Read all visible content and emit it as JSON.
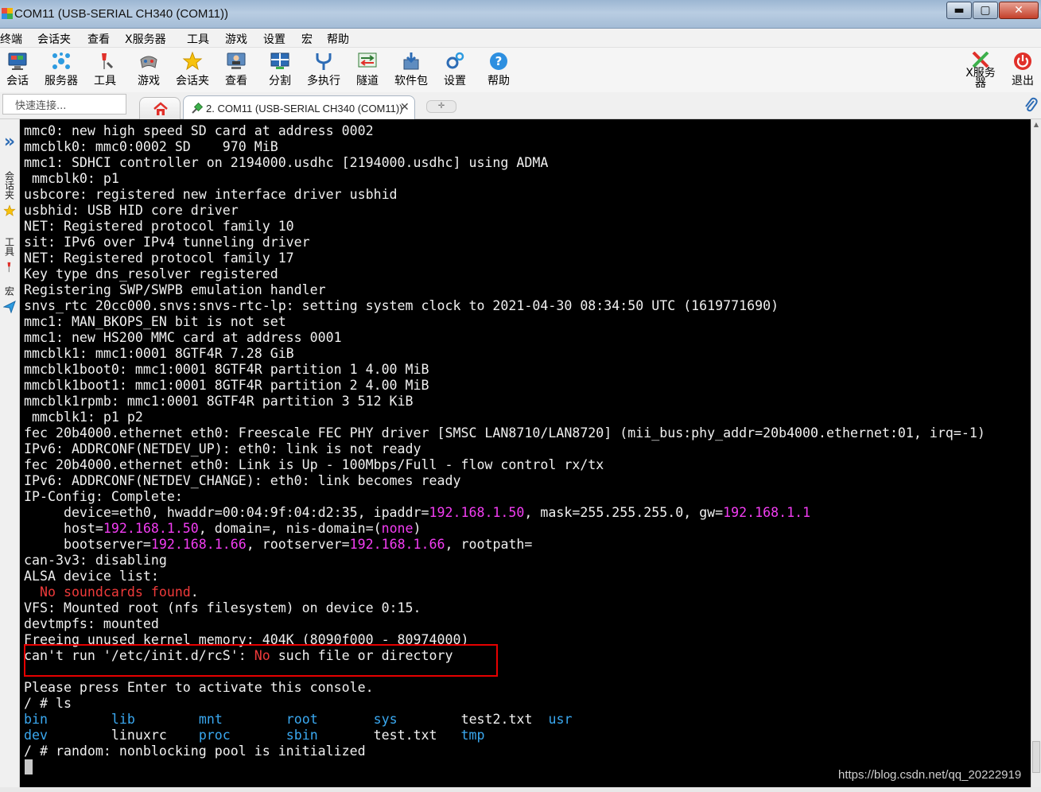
{
  "window": {
    "title": "COM11  (USB-SERIAL CH340 (COM11))",
    "minimize": "▬",
    "maximize": "▢",
    "close": "✕"
  },
  "menu": [
    "终端",
    "会话夹",
    "查看",
    "X服务器",
    "工具",
    "游戏",
    "设置",
    "宏",
    "帮助"
  ],
  "toolbar": {
    "items": [
      {
        "label": "会话",
        "icon": "session-monitor-icon"
      },
      {
        "label": "服务器",
        "icon": "servers-icon"
      },
      {
        "label": "工具",
        "icon": "tools-icon"
      },
      {
        "label": "游戏",
        "icon": "games-icon"
      },
      {
        "label": "会话夹",
        "icon": "star-icon"
      },
      {
        "label": "查看",
        "icon": "view-monitor-icon"
      },
      {
        "label": "分割",
        "icon": "split-icon"
      },
      {
        "label": "多执行",
        "icon": "multi-exec-icon"
      },
      {
        "label": "隧道",
        "icon": "tunnel-icon"
      },
      {
        "label": "软件包",
        "icon": "packages-icon"
      },
      {
        "label": "设置",
        "icon": "settings-icon"
      },
      {
        "label": "帮助",
        "icon": "help-icon"
      }
    ],
    "xserver": {
      "line1": "X服务",
      "line2": "器"
    },
    "exit": "退出"
  },
  "tabs": {
    "quick_connect_placeholder": "快速连接...",
    "session_tab": "2. COM11  (USB-SERIAL CH340 (COM11))",
    "close": "✕",
    "new_tab": "✛"
  },
  "sidebar": {
    "collapse": "»",
    "favorites": "会话夹",
    "tools": "工具",
    "macros": "宏"
  },
  "terminal": {
    "lines": [
      [
        {
          "t": "mmc0: new high speed SD card at address 0002"
        }
      ],
      [
        {
          "t": "mmcblk0: mmc0:0002 SD    970 MiB"
        }
      ],
      [
        {
          "t": "mmc1: SDHCI controller on 2194000.usdhc [2194000.usdhc] using ADMA"
        }
      ],
      [
        {
          "t": " mmcblk0: p1"
        }
      ],
      [
        {
          "t": "usbcore: registered new interface driver usbhid"
        }
      ],
      [
        {
          "t": "usbhid: USB HID core driver"
        }
      ],
      [
        {
          "t": "NET: Registered protocol family 10"
        }
      ],
      [
        {
          "t": "sit: IPv6 over IPv4 tunneling driver"
        }
      ],
      [
        {
          "t": "NET: Registered protocol family 17"
        }
      ],
      [
        {
          "t": "Key type dns_resolver registered"
        }
      ],
      [
        {
          "t": "Registering SWP/SWPB emulation handler"
        }
      ],
      [
        {
          "t": "snvs_rtc 20cc000.snvs:snvs-rtc-lp: setting system clock to 2021-04-30 08:34:50 UTC (1619771690)"
        }
      ],
      [
        {
          "t": "mmc1: MAN_BKOPS_EN bit is not set"
        }
      ],
      [
        {
          "t": "mmc1: new HS200 MMC card at address 0001"
        }
      ],
      [
        {
          "t": "mmcblk1: mmc1:0001 8GTF4R 7.28 GiB"
        }
      ],
      [
        {
          "t": "mmcblk1boot0: mmc1:0001 8GTF4R partition 1 4.00 MiB"
        }
      ],
      [
        {
          "t": "mmcblk1boot1: mmc1:0001 8GTF4R partition 2 4.00 MiB"
        }
      ],
      [
        {
          "t": "mmcblk1rpmb: mmc1:0001 8GTF4R partition 3 512 KiB"
        }
      ],
      [
        {
          "t": " mmcblk1: p1 p2"
        }
      ],
      [
        {
          "t": "fec 20b4000.ethernet eth0: Freescale FEC PHY driver [SMSC LAN8710/LAN8720] (mii_bus:phy_addr=20b4000.ethernet:01, irq=-1)"
        }
      ],
      [
        {
          "t": "IPv6: ADDRCONF(NETDEV_UP): eth0: link is not ready"
        }
      ],
      [
        {
          "t": "fec 20b4000.ethernet eth0: Link is Up - 100Mbps/Full - flow control rx/tx"
        }
      ],
      [
        {
          "t": "IPv6: ADDRCONF(NETDEV_CHANGE): eth0: link becomes ready"
        }
      ],
      [
        {
          "t": "IP-Config: Complete:"
        }
      ],
      [
        {
          "t": "     device=eth0, hwaddr=00:04:9f:04:d2:35, ipaddr="
        },
        {
          "t": "192.168.1.50",
          "c": "ip"
        },
        {
          "t": ", mask=255.255.255.0, gw="
        },
        {
          "t": "192.168.1.1",
          "c": "ip"
        }
      ],
      [
        {
          "t": "     host="
        },
        {
          "t": "192.168.1.50",
          "c": "ip"
        },
        {
          "t": ", domain=, nis-domain=("
        },
        {
          "t": "none",
          "c": "ip"
        },
        {
          "t": ")"
        }
      ],
      [
        {
          "t": "     bootserver="
        },
        {
          "t": "192.168.1.66",
          "c": "ip"
        },
        {
          "t": ", rootserver="
        },
        {
          "t": "192.168.1.66",
          "c": "ip"
        },
        {
          "t": ", rootpath="
        }
      ],
      [
        {
          "t": "can-3v3: disabling"
        }
      ],
      [
        {
          "t": "ALSA device list:"
        }
      ],
      [
        {
          "t": "  No soundcards found",
          "c": "red"
        },
        {
          "t": "."
        }
      ],
      [
        {
          "t": "VFS: Mounted root (nfs filesystem) on device 0:15."
        }
      ],
      [
        {
          "t": "devtmpfs: mounted"
        }
      ],
      [
        {
          "t": "Freeing unused kernel memory: 404K (8090f000 - 80974000)"
        }
      ],
      [
        {
          "t": "can't run '/etc/init.d/rcS': "
        },
        {
          "t": "No",
          "c": "red"
        },
        {
          "t": " such file or directory"
        }
      ],
      [
        {
          "t": ""
        }
      ],
      [
        {
          "t": "Please press Enter to activate this console."
        }
      ],
      [
        {
          "t": "/ # ls"
        }
      ],
      [
        {
          "t": "bin",
          "c": "dir"
        },
        {
          "t": "        "
        },
        {
          "t": "lib",
          "c": "dir"
        },
        {
          "t": "        "
        },
        {
          "t": "mnt",
          "c": "dir"
        },
        {
          "t": "        "
        },
        {
          "t": "root",
          "c": "dir"
        },
        {
          "t": "       "
        },
        {
          "t": "sys",
          "c": "dir"
        },
        {
          "t": "        test2.txt  "
        },
        {
          "t": "usr",
          "c": "dir"
        }
      ],
      [
        {
          "t": "dev",
          "c": "dir"
        },
        {
          "t": "        linuxrc    "
        },
        {
          "t": "proc",
          "c": "dir"
        },
        {
          "t": "       "
        },
        {
          "t": "sbin",
          "c": "dir"
        },
        {
          "t": "       test.txt   "
        },
        {
          "t": "tmp",
          "c": "dir"
        }
      ],
      [
        {
          "t": "/ # random: nonblocking pool is initialized"
        }
      ]
    ]
  },
  "watermark": "https://blog.csdn.net/qq_20222919",
  "colors": {
    "terminal_bg": "#000000",
    "terminal_fg": "#f0f0f0",
    "ip": "#f23df2",
    "error": "#ef3a3a",
    "directory": "#3aa8f0",
    "highlight_box": "#e60000"
  }
}
